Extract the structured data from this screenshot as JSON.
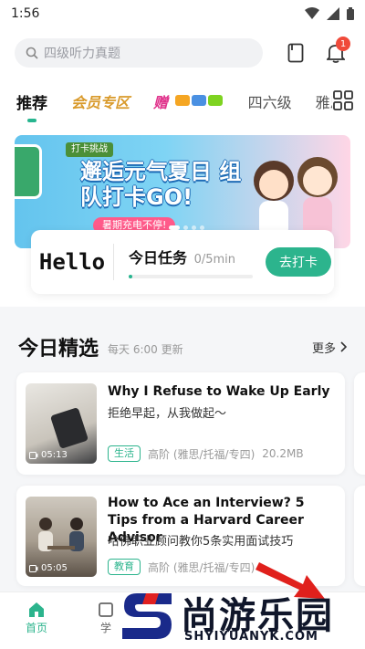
{
  "status": {
    "time": "1:56"
  },
  "search": {
    "placeholder": "四级听力真题"
  },
  "notifications": {
    "count": "1"
  },
  "tabs": [
    {
      "label": "推荐"
    },
    {
      "label": "会员专区"
    },
    {
      "label": "赠"
    },
    {
      "label": "四六级"
    },
    {
      "label": "雅思"
    }
  ],
  "banner": {
    "tag": "打卡挑战",
    "title": "邂逅元气夏日 组队打卡GO!",
    "subtitle": "暑期充电不停!"
  },
  "checkin": {
    "greeting": "Hello",
    "task_title": "今日任务",
    "task_progress": "0/5min",
    "progress_fraction": 0.02,
    "button": "去打卡"
  },
  "section": {
    "title": "今日精选",
    "subtitle": "每天 6:00 更新",
    "more": "更多"
  },
  "items": [
    {
      "title": "Why I Refuse to Wake Up Early",
      "cn": "拒绝早起，从我做起～",
      "duration": "05:13",
      "tag": "生活",
      "level": "高阶 (雅思/托福/专四)",
      "size": "20.2MB"
    },
    {
      "title": "How to Ace an Interview? 5 Tips from a Harvard Career Advisor",
      "cn": "哈佛职业顾问教你5条实用面试技巧",
      "duration": "05:05",
      "tag": "教育",
      "level": "高阶 (雅思/托福/专四)",
      "size": ""
    }
  ],
  "tabbar": [
    {
      "label": "首页",
      "icon": "home-icon"
    },
    {
      "label": "学",
      "icon": "study-icon"
    }
  ],
  "watermark": {
    "text": "尚游乐园",
    "url": "SHYIYUANYK.COM"
  },
  "colors": {
    "accent": "#2cb48d",
    "badge": "#f04a3a"
  }
}
